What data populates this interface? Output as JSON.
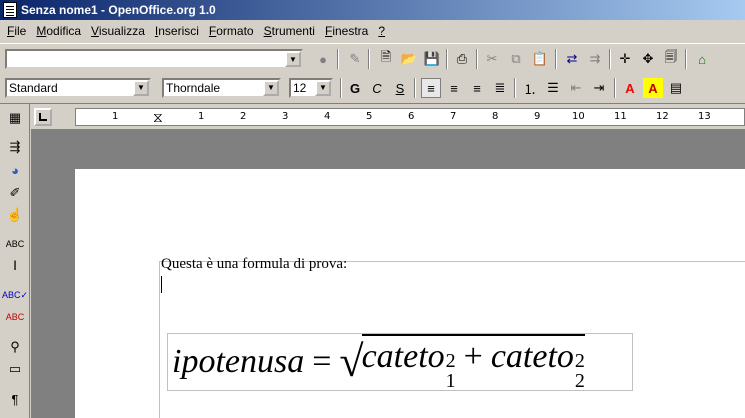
{
  "window": {
    "title": "Senza nome1 - OpenOffice.org 1.0"
  },
  "menu": [
    "File",
    "Modifica",
    "Visualizza",
    "Inserisci",
    "Formato",
    "Strumenti",
    "Finestra",
    "?"
  ],
  "function_bar": {
    "url_value": "",
    "icons": [
      "stop-icon",
      "edit-file-icon",
      "new-document-icon",
      "open-folder-icon",
      "save-icon",
      "print-icon",
      "cut-icon",
      "copy-icon",
      "paste-icon",
      "undo-icon",
      "redo-icon",
      "navigator-icon",
      "stylist-icon",
      "gallery-icon",
      "data-sources-icon"
    ]
  },
  "object_bar": {
    "paragraph_style": "Standard",
    "font_name": "Thorndale",
    "font_size": "12",
    "bold_label": "G",
    "italic_label": "C",
    "underline_label": "S",
    "font_color_label": "A",
    "highlight_label": "A"
  },
  "ruler": {
    "labels": [
      "1",
      "1",
      "2",
      "3",
      "4",
      "5",
      "6",
      "7",
      "8",
      "9",
      "10",
      "11",
      "12",
      "13"
    ]
  },
  "document": {
    "text": "Questa è una formula di prova:",
    "formula": {
      "lhs": "ipotenusa",
      "equals": "=",
      "term1": "cateto",
      "term1_sup": "2",
      "term1_sub": "1",
      "plus": "+",
      "term2": "cateto",
      "term2_sup": "2",
      "term2_sub": "2"
    }
  },
  "colors": {
    "title_gradient_start": "#0a246a",
    "title_gradient_end": "#a6caf0",
    "workspace": "#808080",
    "chrome": "#d4d0c8",
    "font_color": "#ff0000",
    "highlight": "#ffff00"
  }
}
